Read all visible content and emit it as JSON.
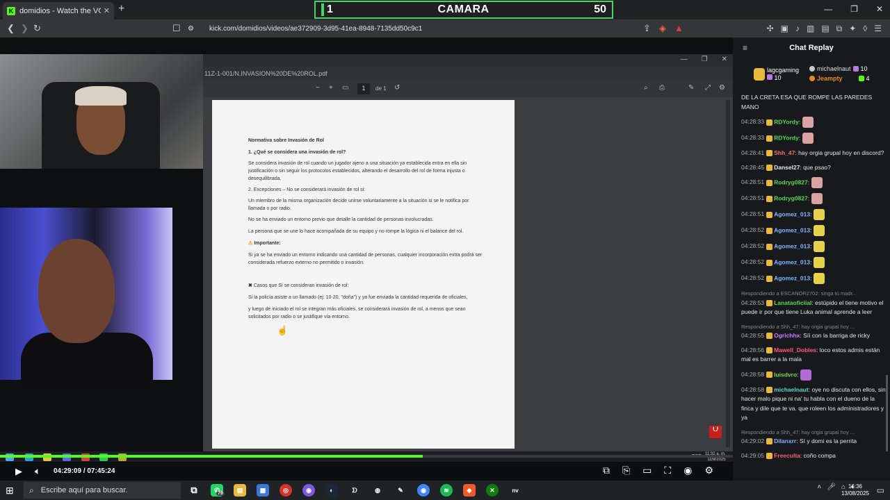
{
  "browser": {
    "tab_title": "domidios - Watch the VOD on K",
    "tab_favicon": "K",
    "url": "kick.com/domidios/videos/ae372909-3d95-41ea-8948-7135dd50c9c1",
    "accent": "#53fc18"
  },
  "scoreboard": {
    "left": "1",
    "name": "CAMARA",
    "right": "50"
  },
  "pdf": {
    "path": "11Z-1-001/N.INVASION%20DE%20ROL.pdf",
    "page_num": "1",
    "page_of": "de 1",
    "heading": "Normativa sobre Invasión de Rol",
    "q1": "1. ¿Qué se considera una invasión de rol?",
    "p1": "Se considera invasión de rol cuando un jugador ajeno a una situación ya establecida entra en ella sin justificación o sin seguir los protocolos establecidos, alterando el desarrollo del rol de forma injusta o desequilibrada.",
    "q2": "2. Excepciones – No se considerará invasión de rol si:",
    "e1": "Un miembro de la misma organización decide unirse voluntariamente a la situación si se le notifica por llamada o por radio.",
    "e2": "No se ha enviado un entorno previo que detalle la cantidad de personas involucradas.",
    "e3": "La persona que se une lo hace acompañada de su equipo y no rompe la lógica ni el balance del rol.",
    "important": "Importante:",
    "p2": "Si ya se ha enviado un entorno indicando una cantidad de personas, cualquier incorporación extra podrá ser considerada refuerzo externo no permitido o invasión.",
    "cases": "Casos que Sí se consideran invasión de rol:",
    "c1": "Si la policía asiste a un llamado (ej: 10-20, \"doña\") y ya fue enviada la cantidad requerida de oficiales,",
    "c2": "y luego de iniciado el rol se integran más oficiales, se considerará invasión de rol, a menos que sean solicitados por radio o se justifique vía entorno."
  },
  "inner_clock": {
    "time": "11:32 a. m.",
    "date": "11/8/2025",
    "lang": "ESP"
  },
  "player": {
    "current": "04:29:09",
    "separator": "/",
    "total": "07:45:24",
    "progress": 0.577
  },
  "chat": {
    "title": "Chat Replay",
    "gifters": [
      {
        "name": "lagcgaming",
        "count": "10",
        "color": "#e8b93a"
      },
      {
        "name": "michaelnaut",
        "count": "10",
        "color": "#c8c8c8"
      },
      {
        "name": "Jeampty",
        "count": "4",
        "color": "#e38a2a"
      }
    ],
    "messages": [
      {
        "ts": "",
        "user": "",
        "color": "#e6e6e6",
        "text": "DE LA CRETA ESA QUE ROMPE LAS PAREDES MANO",
        "reply": ""
      },
      {
        "ts": "04:28:33",
        "user": "RDYordy",
        "color": "#57d957",
        "text": "",
        "reply": ""
      },
      {
        "ts": "04:28:33",
        "user": "RDYordy",
        "color": "#57d957",
        "text": "",
        "reply": ""
      },
      {
        "ts": "04:28:41",
        "user": "Shh_47",
        "color": "#ff6b6b",
        "text": "hay orgia grupal hoy en discord?",
        "reply": ""
      },
      {
        "ts": "04:28:45",
        "user": "Dansel27",
        "color": "#e6e6e6",
        "text": "que psao?",
        "reply": ""
      },
      {
        "ts": "04:28:51",
        "user": "Rodryg0827",
        "color": "#57d957",
        "text": "",
        "reply": ""
      },
      {
        "ts": "04:28:51",
        "user": "Rodryg0827",
        "color": "#57d957",
        "text": "",
        "reply": ""
      },
      {
        "ts": "04:28:51",
        "user": "Agomez_013",
        "color": "#7fb8ff",
        "text": "",
        "reply": ""
      },
      {
        "ts": "04:28:52",
        "user": "Agomez_013",
        "color": "#7fb8ff",
        "text": "",
        "reply": ""
      },
      {
        "ts": "04:28:52",
        "user": "Agomez_013",
        "color": "#7fb8ff",
        "text": "",
        "reply": ""
      },
      {
        "ts": "04:28:52",
        "user": "Agomez_013",
        "color": "#7fb8ff",
        "text": "",
        "reply": ""
      },
      {
        "ts": "04:28:52",
        "user": "Agomez_013",
        "color": "#7fb8ff",
        "text": "",
        "reply": ""
      },
      {
        "ts": "04:28:53",
        "user": "Lanataoficiial",
        "color": "#57d957",
        "text": "estúpido el tiene motivo el puede ir por que tiene Luka animal aprende a leer",
        "reply": "Respondiendo a ESCANOR2702: singa tú madr..."
      },
      {
        "ts": "04:28:55",
        "user": "Ogrichhx",
        "color": "#c77dff",
        "text": "Síí con la barriga de ricky",
        "reply": "Respondiendo a Shh_47: hay orgia grupal hoy ..."
      },
      {
        "ts": "04:28:56",
        "user": "Mawell_Dobles",
        "color": "#ff5a7a",
        "text": "loco estos admis están mal es barrer a la mala",
        "reply": ""
      },
      {
        "ts": "04:28:58",
        "user": "luisdvro",
        "color": "#7cd957",
        "text": "",
        "reply": ""
      },
      {
        "ts": "04:28:58",
        "user": "michaelnaut",
        "color": "#57d9c8",
        "text": "oye no discuta con ellos, sin hacer malo pique ni na' tu habla con el dueno de la finca y dile que te va. que roleen los administradores y ya",
        "reply": ""
      },
      {
        "ts": "04:29:02",
        "user": "Dilanxrr",
        "color": "#7fb8ff",
        "text": "Sí y domi es la perrita",
        "reply": "Respondiendo a Shh_47: hay orgia grupal hoy ..."
      },
      {
        "ts": "04:29:05",
        "user": "Freeculta",
        "color": "#ff5a7a",
        "text": "coño compa",
        "reply": ""
      }
    ]
  },
  "taskbar": {
    "search_placeholder": "Escribe aquí para buscar.",
    "whatsapp_badge": "79",
    "time": "16:36",
    "date": "13/08/2025"
  }
}
